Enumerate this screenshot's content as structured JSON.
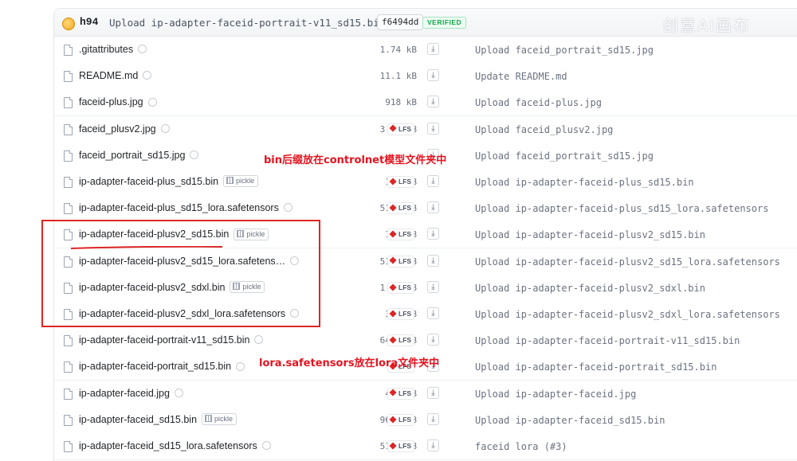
{
  "commit": {
    "author": "h94",
    "message": "Upload ip-adapter-faceid-portrait-v11_sd15.bin",
    "hash": "f6494dd",
    "verified": "VERIFIED"
  },
  "watermark": "创意AI画布",
  "badges": {
    "lfs": "LFS",
    "pickle": "pickle"
  },
  "files": [
    {
      "name": ".gitattributes",
      "size": "1.74 kB",
      "lfs": false,
      "pickle": false,
      "commit": "Upload faceid_portrait_sd15.jpg"
    },
    {
      "name": "README.md",
      "size": "11.1 kB",
      "lfs": false,
      "pickle": false,
      "commit": "Update README.md"
    },
    {
      "name": "faceid-plus.jpg",
      "size": "918 kB",
      "lfs": false,
      "pickle": false,
      "commit": "Upload faceid-plus.jpg"
    },
    {
      "name": "faceid_plusv2.jpg",
      "size": "3.44 MB",
      "lfs": true,
      "pickle": false,
      "commit": "Upload faceid_plusv2.jpg"
    },
    {
      "name": "faceid_portrait_sd15.jpg",
      "size": "",
      "lfs": false,
      "pickle": false,
      "commit": "Upload faceid_portrait_sd15.jpg"
    },
    {
      "name": "ip-adapter-faceid-plus_sd15.bin",
      "size": "157 MB",
      "lfs": true,
      "pickle": true,
      "commit": "Upload ip-adapter-faceid-plus_sd15.bin"
    },
    {
      "name": "ip-adapter-faceid-plus_sd15_lora.safetensors",
      "size": "51.1 MB",
      "lfs": true,
      "pickle": false,
      "commit": "Upload ip-adapter-faceid-plus_sd15_lora.safetensors"
    },
    {
      "name": "ip-adapter-faceid-plusv2_sd15.bin",
      "size": "157 MB",
      "lfs": true,
      "pickle": true,
      "commit": "Upload ip-adapter-faceid-plusv2_sd15.bin"
    },
    {
      "name": "ip-adapter-faceid-plusv2_sd15_lora.safetens…",
      "size": "51.1 MB",
      "lfs": true,
      "pickle": false,
      "commit": "Upload ip-adapter-faceid-plusv2_sd15_lora.safetensors"
    },
    {
      "name": "ip-adapter-faceid-plusv2_sdxl.bin",
      "size": "1.49 GB",
      "lfs": true,
      "pickle": true,
      "commit": "Upload ip-adapter-faceid-plusv2_sdxl.bin"
    },
    {
      "name": "ip-adapter-faceid-plusv2_sdxl_lora.safetensors",
      "size": "372 MB",
      "lfs": true,
      "pickle": false,
      "commit": "Upload ip-adapter-faceid-plusv2_sdxl_lora.safetensors"
    },
    {
      "name": "ip-adapter-faceid-portrait-v11_sd15.bin",
      "size": "64.6 MB",
      "lfs": true,
      "pickle": false,
      "commit": "Upload ip-adapter-faceid-portrait-v11_sd15.bin"
    },
    {
      "name": "ip-adapter-faceid-portrait_sd15.bin",
      "size": "",
      "lfs": true,
      "pickle": false,
      "commit": "Upload ip-adapter-faceid-portrait_sd15.bin"
    },
    {
      "name": "ip-adapter-faceid.jpg",
      "size": "4.7 MB",
      "lfs": true,
      "pickle": false,
      "commit": "Upload ip-adapter-faceid.jpg"
    },
    {
      "name": "ip-adapter-faceid_sd15.bin",
      "size": "96.7 MB",
      "lfs": true,
      "pickle": true,
      "commit": "Upload ip-adapter-faceid_sd15.bin"
    },
    {
      "name": "ip-adapter-faceid_sd15_lora.safetensors",
      "size": "51.1 MB",
      "lfs": true,
      "pickle": false,
      "commit": "faceid lora (#3)"
    }
  ],
  "annotations": {
    "bin_note": "bin后缀放在controlnet模型文件夹中",
    "lora_note": "lora.safetensors放在lora文件夹中"
  },
  "colors": {
    "annotation": "#e5131f",
    "lfs_icon": "#dc2626",
    "verified": "#16a34a"
  }
}
